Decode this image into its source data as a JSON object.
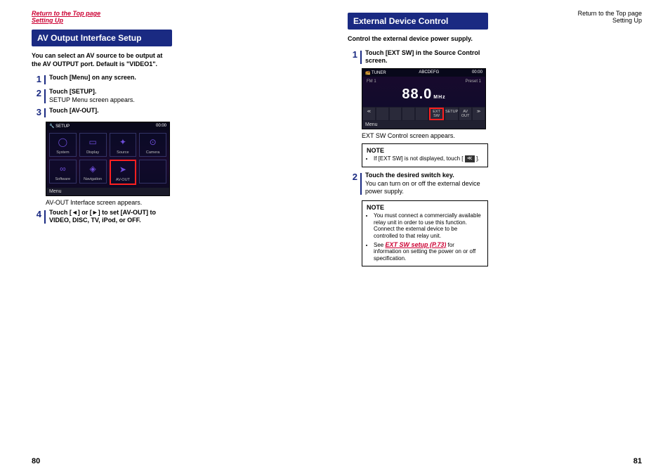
{
  "nav": {
    "return_top": "Return to the Top page",
    "setting_up": "Setting Up"
  },
  "left": {
    "header": "AV Output Interface Setup",
    "intro": "You can select an AV source to be output at the AV OUTPUT port. Default is \"VIDEO1\".",
    "steps": {
      "s1": "Touch [Menu] on any screen.",
      "s2": "Touch [SETUP].",
      "s2b": "SETUP Menu screen appears.",
      "s3": "Touch [AV-OUT].",
      "caption": "AV-OUT Interface screen appears.",
      "s4": "Touch [◄] or [►] to set [AV-OUT] to VIDEO, DISC, TV, iPod, or OFF."
    },
    "shot": {
      "title": "SETUP",
      "clock": "00:00",
      "tiles": [
        "System",
        "Display",
        "Source",
        "Camera",
        "Software",
        "Navigation",
        "AV-OUT",
        ""
      ],
      "menu": "Menu"
    },
    "page": "80"
  },
  "right": {
    "header": "External Device Control",
    "intro": "Control the external device power supply.",
    "steps": {
      "s1": "Touch [EXT SW] in the Source Control screen.",
      "caption1": "EXT SW Control screen appears.",
      "s2": "Touch the desired switch key.",
      "s2b": "You can turn on or off the external device power supply."
    },
    "tshot": {
      "title": "TUNER",
      "center_top": "ABCDEFG",
      "clock": "00:00",
      "band": "FM 1",
      "preset": "Preset 1",
      "freq_main": "88.0",
      "freq_unit": "MHz",
      "btns": [
        "≪",
        "",
        "",
        "",
        "",
        "EXT SW",
        "SETUP",
        "AV OUT",
        "≫"
      ],
      "menu": "Menu"
    },
    "note1": {
      "head": "NOTE",
      "line_a": "If [EXT SW] is not displayed, touch [",
      "line_b": "]."
    },
    "note2": {
      "head": "NOTE",
      "li1": "You must connect a commercially available relay unit in order to use this function. Connect the external device to be controlled to that relay unit.",
      "li2a": "See ",
      "li2link": "EXT SW setup (P.73)",
      "li2b": " for information on setting the power on or off specification."
    },
    "page": "81"
  }
}
